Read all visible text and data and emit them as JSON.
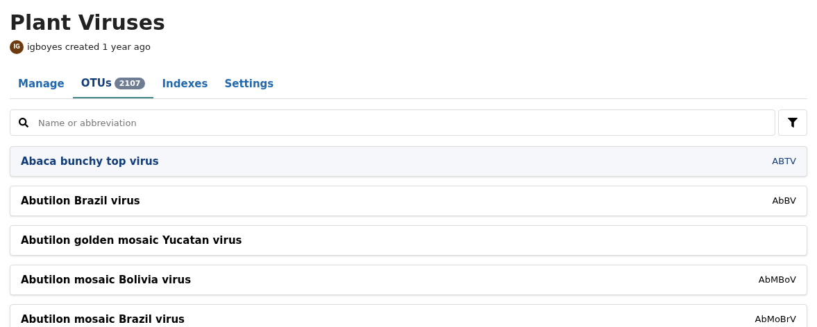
{
  "title": "Plant Viruses",
  "creator": {
    "initials": "IG",
    "text": "igboyes created 1 year ago"
  },
  "tabs": [
    {
      "label": "Manage",
      "selected": false
    },
    {
      "label": "OTUs",
      "count": "2107",
      "selected": true
    },
    {
      "label": "Indexes",
      "selected": false
    },
    {
      "label": "Settings",
      "selected": false
    }
  ],
  "search": {
    "placeholder": "Name or abbreviation"
  },
  "otus": [
    {
      "name": "Abaca bunchy top virus",
      "abbreviation": "ABTV",
      "highlighted": true
    },
    {
      "name": "Abutilon Brazil virus",
      "abbreviation": "AbBV",
      "highlighted": false
    },
    {
      "name": "Abutilon golden mosaic Yucatan virus",
      "highlighted": false
    },
    {
      "name": "Abutilon mosaic Bolivia virus",
      "abbreviation": "AbMBoV",
      "highlighted": false
    },
    {
      "name": "Abutilon mosaic Brazil virus",
      "abbreviation": "AbMoBrV",
      "highlighted": false
    }
  ]
}
